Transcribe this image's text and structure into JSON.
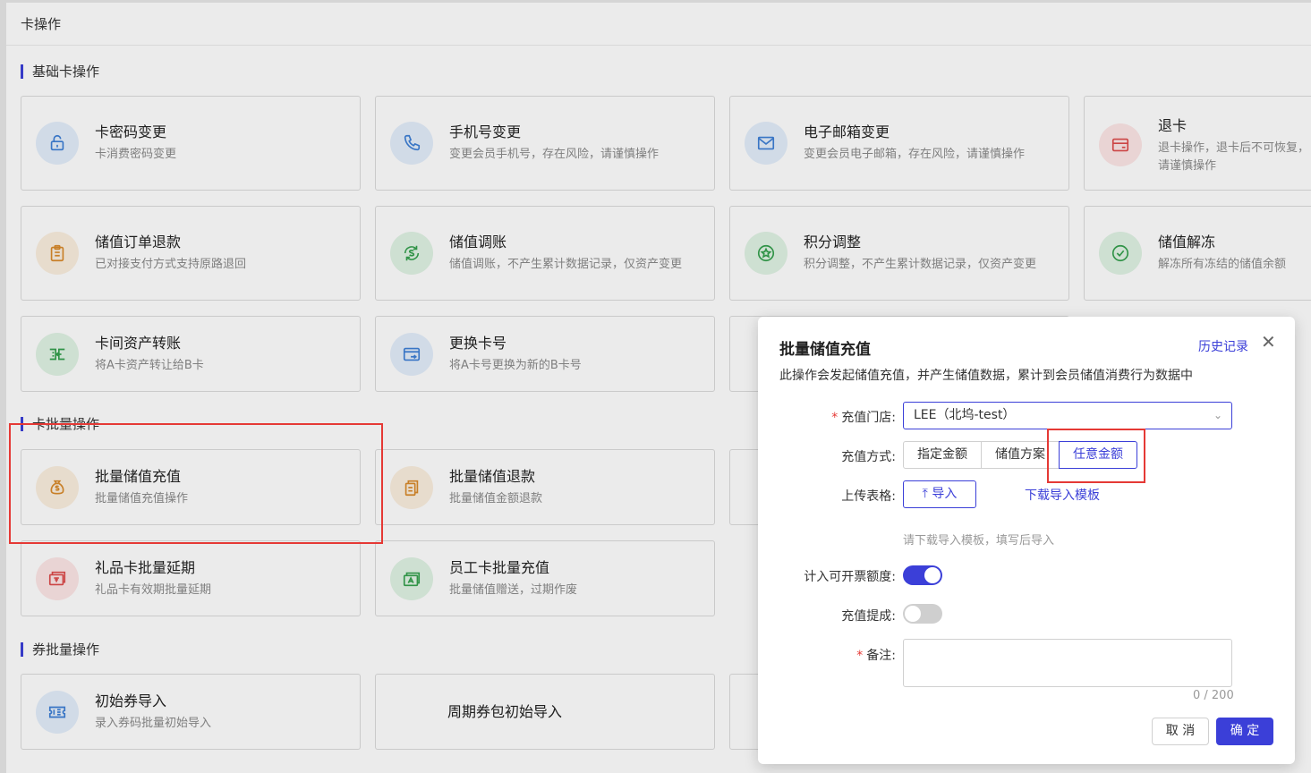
{
  "page": {
    "title": "卡操作"
  },
  "sections": {
    "basic": "基础卡操作",
    "batch": "卡批量操作",
    "coupon": "券批量操作"
  },
  "cards": {
    "pwd": {
      "title": "卡密码变更",
      "desc": "卡消费密码变更"
    },
    "phone": {
      "title": "手机号变更",
      "desc": "变更会员手机号，存在风险，请谨慎操作"
    },
    "email": {
      "title": "电子邮箱变更",
      "desc": "变更会员电子邮箱，存在风险，请谨慎操作"
    },
    "refund_card": {
      "title": "退卡",
      "desc": "退卡操作，退卡后不可恢复，请谨慎操作"
    },
    "order_refund": {
      "title": "储值订单退款",
      "desc": "已对接支付方式支持原路退回"
    },
    "adjust": {
      "title": "储值调账",
      "desc": "储值调账，不产生累计数据记录，仅资产变更"
    },
    "points": {
      "title": "积分调整",
      "desc": "积分调整，不产生累计数据记录，仅资产变更"
    },
    "unfreeze": {
      "title": "储值解冻",
      "desc": "解冻所有冻结的储值余额"
    },
    "transfer": {
      "title": "卡间资产转账",
      "desc": "将A卡资产转让给B卡"
    },
    "replace": {
      "title": "更换卡号",
      "desc": "将A卡号更换为新的B卡号"
    },
    "batch_recharge": {
      "title": "批量储值充值",
      "desc": "批量储值充值操作"
    },
    "batch_refund": {
      "title": "批量储值退款",
      "desc": "批量储值金额退款"
    },
    "gift_extend": {
      "title": "礼品卡批量延期",
      "desc": "礼品卡有效期批量延期"
    },
    "staff_recharge": {
      "title": "员工卡批量充值",
      "desc": "批量储值赠送，过期作废"
    },
    "coupon_import": {
      "title": "初始券导入",
      "desc": "录入券码批量初始导入"
    },
    "cycle_import": {
      "title": "周期券包初始导入"
    }
  },
  "modal": {
    "title": "批量储值充值",
    "history": "历史记录",
    "close": "✕",
    "desc": "此操作会发起储值充值，并产生储值数据，累计到会员储值消费行为数据中",
    "store_label": "充值门店:",
    "store_value": "LEE（北坞-test）",
    "method_label": "充值方式:",
    "methods": [
      "指定金额",
      "储值方案",
      "任意金额"
    ],
    "selected_method": "任意金额",
    "upload_label": "上传表格:",
    "upload_btn": "导入",
    "template_link": "下载导入模板",
    "hint": "请下载导入模板，填写后导入",
    "invoice_label": "计入可开票额度:",
    "invoice_on": true,
    "commission_label": "充值提成:",
    "commission_on": false,
    "remark_label": "备注:",
    "remark_value": "",
    "counter": "0 / 200",
    "cancel": "取 消",
    "ok": "确 定"
  },
  "colors": {
    "accent": "#3b3fd8",
    "highlight": "#e53935"
  }
}
